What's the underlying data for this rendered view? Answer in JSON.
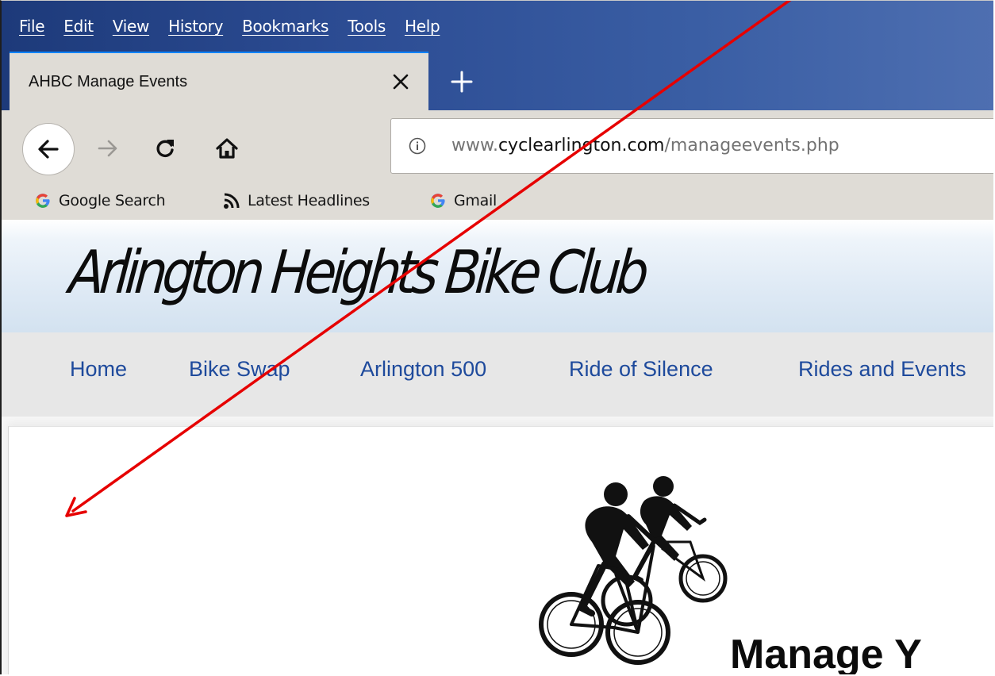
{
  "browser": {
    "menu": [
      {
        "label": "File"
      },
      {
        "label": "Edit"
      },
      {
        "label": "View"
      },
      {
        "label": "History"
      },
      {
        "label": "Bookmarks"
      },
      {
        "label": "Tools"
      },
      {
        "label": "Help"
      }
    ],
    "tab": {
      "title": "AHBC Manage Events",
      "close_icon": "close-icon"
    },
    "new_tab_icon": "plus-icon",
    "nav": {
      "back_icon": "back-arrow-icon",
      "forward_icon": "forward-arrow-icon",
      "reload_icon": "reload-icon",
      "home_icon": "home-icon"
    },
    "url": {
      "prefix": "www.",
      "domain": "cyclearlington.com",
      "path": "/manageevents.php",
      "info_icon": "info-icon"
    },
    "bookmarks": [
      {
        "label": "Google Search",
        "icon": "google-icon"
      },
      {
        "label": "Latest Headlines",
        "icon": "rss-icon"
      },
      {
        "label": "Gmail",
        "icon": "google-icon"
      }
    ],
    "accent_color": "#0a84ff",
    "titlebar_color": "#2c4c93"
  },
  "site": {
    "title": "Arlington Heights Bike Club",
    "nav": [
      {
        "label": "Home"
      },
      {
        "label": "Bike Swap"
      },
      {
        "label": "Arlington 500"
      },
      {
        "label": "Ride of Silence"
      },
      {
        "label": "Rides and Events"
      }
    ],
    "nav_link_color": "#1e4a9c",
    "logo_icon": "cyclists-logo",
    "heading": "Manage Y"
  },
  "annotation": {
    "type": "arrow",
    "color": "#e60000"
  }
}
